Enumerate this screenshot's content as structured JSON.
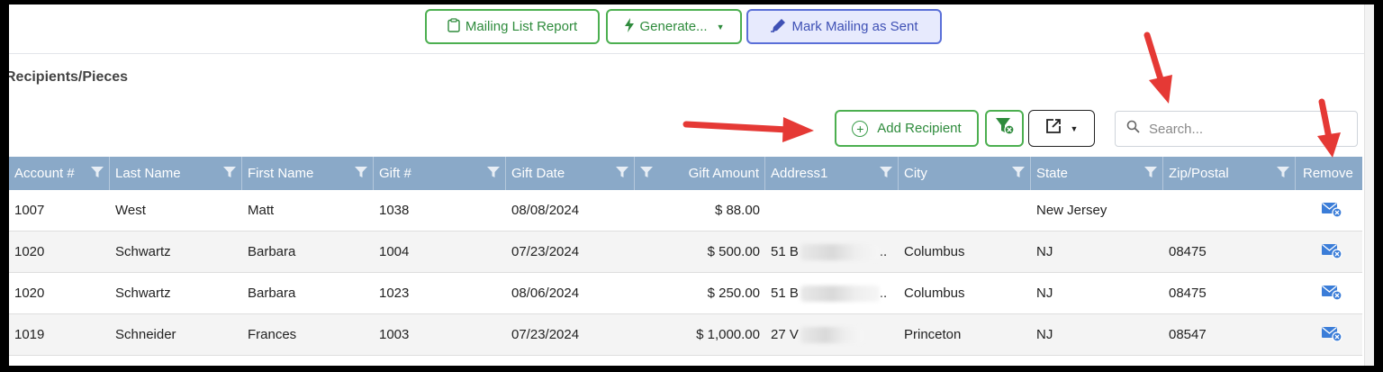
{
  "toolbar": {
    "mailing_list_report": "Mailing List Report",
    "generate": "Generate...",
    "mark_sent": "Mark Mailing as Sent"
  },
  "section_title": "Recipients/Pieces",
  "actions": {
    "add_recipient": "Add Recipient"
  },
  "search": {
    "placeholder": "Search..."
  },
  "table": {
    "columns": [
      "Account #",
      "Last Name",
      "First Name",
      "Gift #",
      "Gift Date",
      "Gift Amount",
      "Address1",
      "City",
      "State",
      "Zip/Postal",
      "Remove"
    ],
    "rows": [
      {
        "account": "1007",
        "last": "West",
        "first": "Matt",
        "gift": "1038",
        "date": "08/08/2024",
        "amount": "$ 88.00",
        "address": "",
        "city": "",
        "state": "New Jersey",
        "zip": ""
      },
      {
        "account": "1020",
        "last": "Schwartz",
        "first": "Barbara",
        "gift": "1004",
        "date": "07/23/2024",
        "amount": "$ 500.00",
        "address": "51 B",
        "address_tail": "..",
        "city": "Columbus",
        "state": "NJ",
        "zip": "08475"
      },
      {
        "account": "1020",
        "last": "Schwartz",
        "first": "Barbara",
        "gift": "1023",
        "date": "08/06/2024",
        "amount": "$ 250.00",
        "address": "51 B",
        "address_tail": "..",
        "city": "Columbus",
        "state": "NJ",
        "zip": "08475"
      },
      {
        "account": "1019",
        "last": "Schneider",
        "first": "Frances",
        "gift": "1003",
        "date": "07/23/2024",
        "amount": "$ 1,000.00",
        "address": "27 V",
        "address_tail": "",
        "city": "Princeton",
        "state": "NJ",
        "zip": "08547"
      }
    ]
  },
  "icons": {
    "report": "clipboard-icon",
    "generate": "lightning-icon",
    "mark_sent": "pen-icon",
    "add": "plus-circle-icon",
    "clear_filter": "filter-clear-icon",
    "export": "export-icon",
    "search": "search-icon",
    "remove": "envelope-remove-icon",
    "annotation": "red-arrow-icon"
  },
  "colors": {
    "green": "#4caf50",
    "blue_button_bg": "#e7eafd",
    "blue_button_border": "#5a6fd8",
    "header": "#8aa9c8",
    "remove_icon": "#3b7dd8",
    "arrow": "#e53935"
  }
}
